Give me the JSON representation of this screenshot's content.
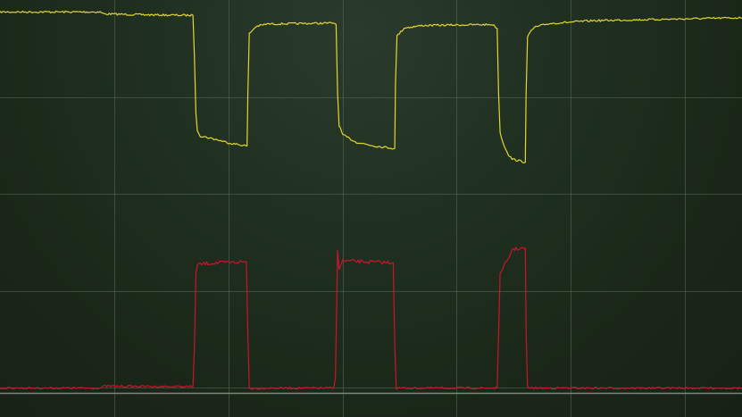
{
  "chart_data": {
    "type": "line",
    "title": "",
    "xlabel": "",
    "ylabel": "",
    "xlim": [
      0,
      10
    ],
    "ylim": [
      0,
      8
    ],
    "grid": true,
    "grid_divisions": {
      "x": 6.5,
      "y": 4.3
    },
    "legend": "none",
    "series": [
      {
        "color": "#e3d632",
        "points": [
          [
            0.0,
            7.9
          ],
          [
            1.35,
            7.9
          ],
          [
            1.4,
            7.86
          ],
          [
            2.0,
            7.84
          ],
          [
            2.6,
            7.83
          ],
          [
            2.62,
            7.0
          ],
          [
            2.64,
            5.8
          ],
          [
            2.66,
            5.45
          ],
          [
            2.7,
            5.33
          ],
          [
            2.9,
            5.26
          ],
          [
            3.1,
            5.18
          ],
          [
            3.33,
            5.12
          ],
          [
            3.34,
            6.2
          ],
          [
            3.36,
            7.45
          ],
          [
            3.45,
            7.6
          ],
          [
            3.6,
            7.65
          ],
          [
            4.5,
            7.67
          ],
          [
            4.53,
            7.64
          ],
          [
            4.55,
            6.2
          ],
          [
            4.57,
            5.55
          ],
          [
            4.62,
            5.35
          ],
          [
            4.8,
            5.2
          ],
          [
            5.05,
            5.12
          ],
          [
            5.32,
            5.07
          ],
          [
            5.33,
            6.4
          ],
          [
            5.35,
            7.4
          ],
          [
            5.45,
            7.57
          ],
          [
            5.7,
            7.62
          ],
          [
            6.64,
            7.64
          ],
          [
            6.7,
            7.56
          ],
          [
            6.72,
            6.2
          ],
          [
            6.74,
            5.4
          ],
          [
            6.78,
            5.18
          ],
          [
            6.85,
            4.95
          ],
          [
            6.9,
            4.85
          ],
          [
            7.08,
            4.78
          ],
          [
            7.09,
            6.2
          ],
          [
            7.11,
            7.4
          ],
          [
            7.2,
            7.58
          ],
          [
            7.4,
            7.66
          ],
          [
            8.0,
            7.72
          ],
          [
            9.0,
            7.75
          ],
          [
            10.0,
            7.78
          ]
        ]
      },
      {
        "color": "#c9152e",
        "points": [
          [
            0.0,
            0.1
          ],
          [
            1.35,
            0.1
          ],
          [
            1.4,
            0.14
          ],
          [
            2.6,
            0.13
          ],
          [
            2.62,
            0.9
          ],
          [
            2.64,
            2.5
          ],
          [
            2.66,
            2.65
          ],
          [
            2.75,
            2.68
          ],
          [
            3.0,
            2.7
          ],
          [
            3.32,
            2.72
          ],
          [
            3.34,
            1.2
          ],
          [
            3.36,
            0.09
          ],
          [
            3.6,
            0.1
          ],
          [
            4.5,
            0.1
          ],
          [
            4.52,
            0.3
          ],
          [
            4.55,
            2.95
          ],
          [
            4.57,
            2.6
          ],
          [
            4.62,
            2.74
          ],
          [
            4.9,
            2.72
          ],
          [
            5.3,
            2.7
          ],
          [
            5.32,
            1.0
          ],
          [
            5.34,
            0.1
          ],
          [
            6.0,
            0.1
          ],
          [
            6.7,
            0.1
          ],
          [
            6.72,
            1.2
          ],
          [
            6.74,
            2.45
          ],
          [
            6.78,
            2.62
          ],
          [
            6.85,
            2.75
          ],
          [
            6.9,
            2.98
          ],
          [
            7.08,
            3.0
          ],
          [
            7.09,
            1.3
          ],
          [
            7.11,
            0.1
          ],
          [
            8.0,
            0.1
          ],
          [
            9.0,
            0.1
          ],
          [
            10.0,
            0.1
          ]
        ]
      }
    ]
  }
}
